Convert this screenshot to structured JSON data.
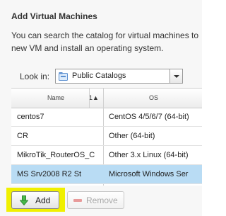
{
  "dialog": {
    "title": "Add Virtual Machines",
    "description_line1": "You can search the catalog for virtual machines to",
    "description_line2": "new VM and install an operating system."
  },
  "look_in": {
    "label": "Look in:",
    "selected": "Public Catalogs",
    "icon": "folder-icon"
  },
  "grid": {
    "columns": [
      {
        "label": "Name"
      },
      {
        "label": "OS"
      }
    ],
    "sort_indicator": "1▲",
    "rows": [
      {
        "name": "centos7",
        "os": "CentOS 4/5/6/7 (64-bit)",
        "selected": false
      },
      {
        "name": "CR",
        "os": "Other (64-bit)",
        "selected": false
      },
      {
        "name": "MikroTik_RouterOS_C",
        "os": "Other 3.x Linux (64-bit)",
        "selected": false
      },
      {
        "name": "MS Srv2008 R2 St",
        "os": "Microsoft Windows Ser",
        "selected": true
      }
    ],
    "selected_row_color": "#b9dcf4"
  },
  "actions": {
    "add_label": "Add",
    "add_icon": "arrow-down-icon",
    "remove_label": "Remove",
    "remove_icon": "minus-icon",
    "remove_enabled": false,
    "highlight_color": "#f0f000"
  }
}
